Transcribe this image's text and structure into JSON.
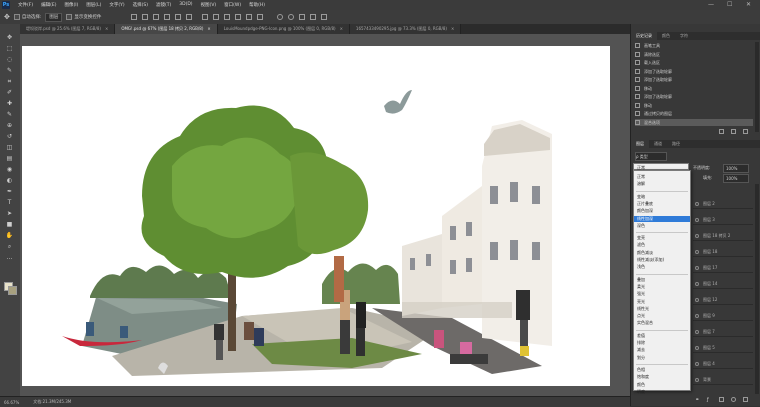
{
  "app": {
    "logo": "Ps",
    "menu": [
      "文件(F)",
      "编辑(E)",
      "图像(I)",
      "图层(L)",
      "文字(Y)",
      "选择(S)",
      "滤镜(T)",
      "3D(D)",
      "视图(V)",
      "窗口(W)",
      "帮助(H)"
    ],
    "window_controls": [
      "—",
      "☐",
      "✕"
    ]
  },
  "options": {
    "auto_select_label": "自动选择:",
    "auto_select_value": "图层",
    "transform_label": "显示变换控件"
  },
  "tabs": [
    {
      "label": "堤坝驳岸.psd @ 25.6% (图层 7, RGB/8)",
      "active": false
    },
    {
      "label": "OMG!.psd @ 67% (图层 18 拷贝 2, RGB/8)",
      "active": true
    },
    {
      "label": "LouisMoundpdge-PNG-Icon.png @ 100% (图层 0, RGB/8)",
      "active": false
    },
    {
      "label": "1657433490295.jpg @ 73.3% (图层 0, RGB/8)",
      "active": false
    }
  ],
  "status": {
    "zoom": "66.67%",
    "doc": "文档:21.3M/245.3M"
  },
  "history_panel": {
    "tabs": [
      "历史记录",
      "颜色",
      "字符"
    ],
    "items": [
      {
        "label": "画笔工具",
        "current": false
      },
      {
        "label": "清除选区",
        "current": false
      },
      {
        "label": "载入选区",
        "current": false
      },
      {
        "label": "添加了选取轮廓",
        "current": false
      },
      {
        "label": "添加了选取轮廓",
        "current": false
      },
      {
        "label": "移动",
        "current": false
      },
      {
        "label": "添加了选取轮廓",
        "current": false
      },
      {
        "label": "移动",
        "current": false
      },
      {
        "label": "通过拷贝的图层",
        "current": false
      },
      {
        "label": "混合选项",
        "current": true
      }
    ]
  },
  "layers_panel": {
    "tabs": [
      "图层",
      "通道",
      "路径"
    ],
    "filter_label": "ρ 类型",
    "opacity_label": "不透明度:",
    "opacity_value": "100%",
    "fill_label": "填充:",
    "fill_value": "100%",
    "lock_label": "锁定:",
    "rows": [
      "图层 2",
      "图层 3",
      "图层 18 拷贝 2",
      "图层 18",
      "图层 17",
      "图层 14",
      "图层 12",
      "图层 9",
      "图层 7",
      "图层 5",
      "图层 4",
      "背景"
    ]
  },
  "blend_mode": {
    "current": "正常",
    "selected_index": 5,
    "items": [
      "正常",
      "溶解",
      "变暗",
      "正片叠底",
      "颜色加深",
      "线性加深",
      "深色",
      "变亮",
      "滤色",
      "颜色减淡",
      "线性减淡(添加)",
      "浅色",
      "叠加",
      "柔光",
      "强光",
      "亮光",
      "线性光",
      "点光",
      "实色混合",
      "差值",
      "排除",
      "减去",
      "划分",
      "色相",
      "饱和度",
      "颜色",
      "明度"
    ],
    "group_breaks": [
      2,
      7,
      12,
      19,
      23
    ]
  },
  "colors": {
    "accent": "#2f7bd8",
    "canvas_bg": "#535353",
    "ui_dark": "#323232"
  }
}
